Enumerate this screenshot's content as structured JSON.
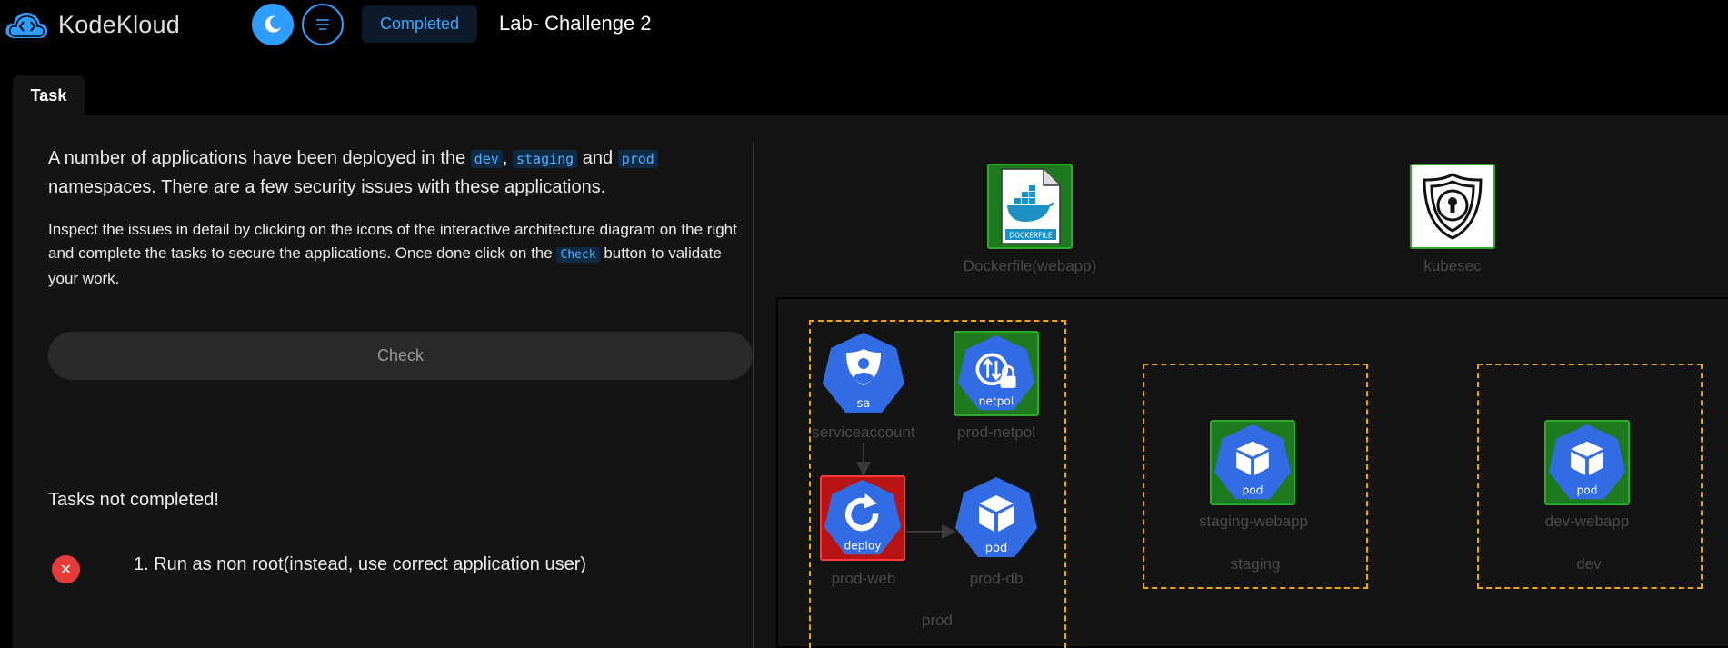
{
  "app": {
    "logo_text": "KodeKloud",
    "lab_title": "Lab- Challenge 2",
    "status": "Completed"
  },
  "tabs": [
    {
      "label": "Task"
    }
  ],
  "task": {
    "p1_a": "A number of applications have been deployed in the",
    "ns_dev": "dev",
    "comma": ",",
    "ns_staging": "staging",
    "and": "and",
    "ns_prod": "prod",
    "p1_b": "namespaces. There are a few security issues with these applications.",
    "p2_a": "Inspect the issues in detail by clicking on the icons of the interactive architecture diagram on the right and complete the tasks to secure the applications. Once done click on the",
    "p2_code": "Check",
    "p2_b": "button to validate your work.",
    "check_button": "Check",
    "tasks_status": "Tasks not completed!",
    "items": [
      {
        "text": "1. Run as non root(instead, use correct application user)",
        "done": false
      }
    ]
  },
  "diagram": {
    "top": [
      {
        "label": "Dockerfile(webapp)",
        "icon": "dockerfile-icon",
        "icon_text": "DOCKERFILE"
      },
      {
        "label": "kubesec",
        "icon": "kubesec-shield-icon"
      }
    ],
    "nodes": {
      "sa": {
        "badge": "sa",
        "label": "serviceaccount",
        "status": "none"
      },
      "netpol": {
        "badge": "netpol",
        "label": "prod-netpol",
        "status": "ok"
      },
      "deploy": {
        "badge": "deploy",
        "label": "prod-web",
        "status": "fail"
      },
      "proddb": {
        "badge": "pod",
        "label": "prod-db",
        "status": "none"
      },
      "staging": {
        "badge": "pod",
        "label": "staging-webapp",
        "status": "ok"
      },
      "dev": {
        "badge": "pod",
        "label": "dev-webapp",
        "status": "ok"
      }
    },
    "namespaces": {
      "prod": "prod",
      "staging": "staging",
      "dev": "dev"
    },
    "colors": {
      "k8s_blue": "#326ce5",
      "ok_green": "#1e7a1e",
      "fail_red": "#b81414",
      "namespace_border": "#f0a800"
    }
  }
}
